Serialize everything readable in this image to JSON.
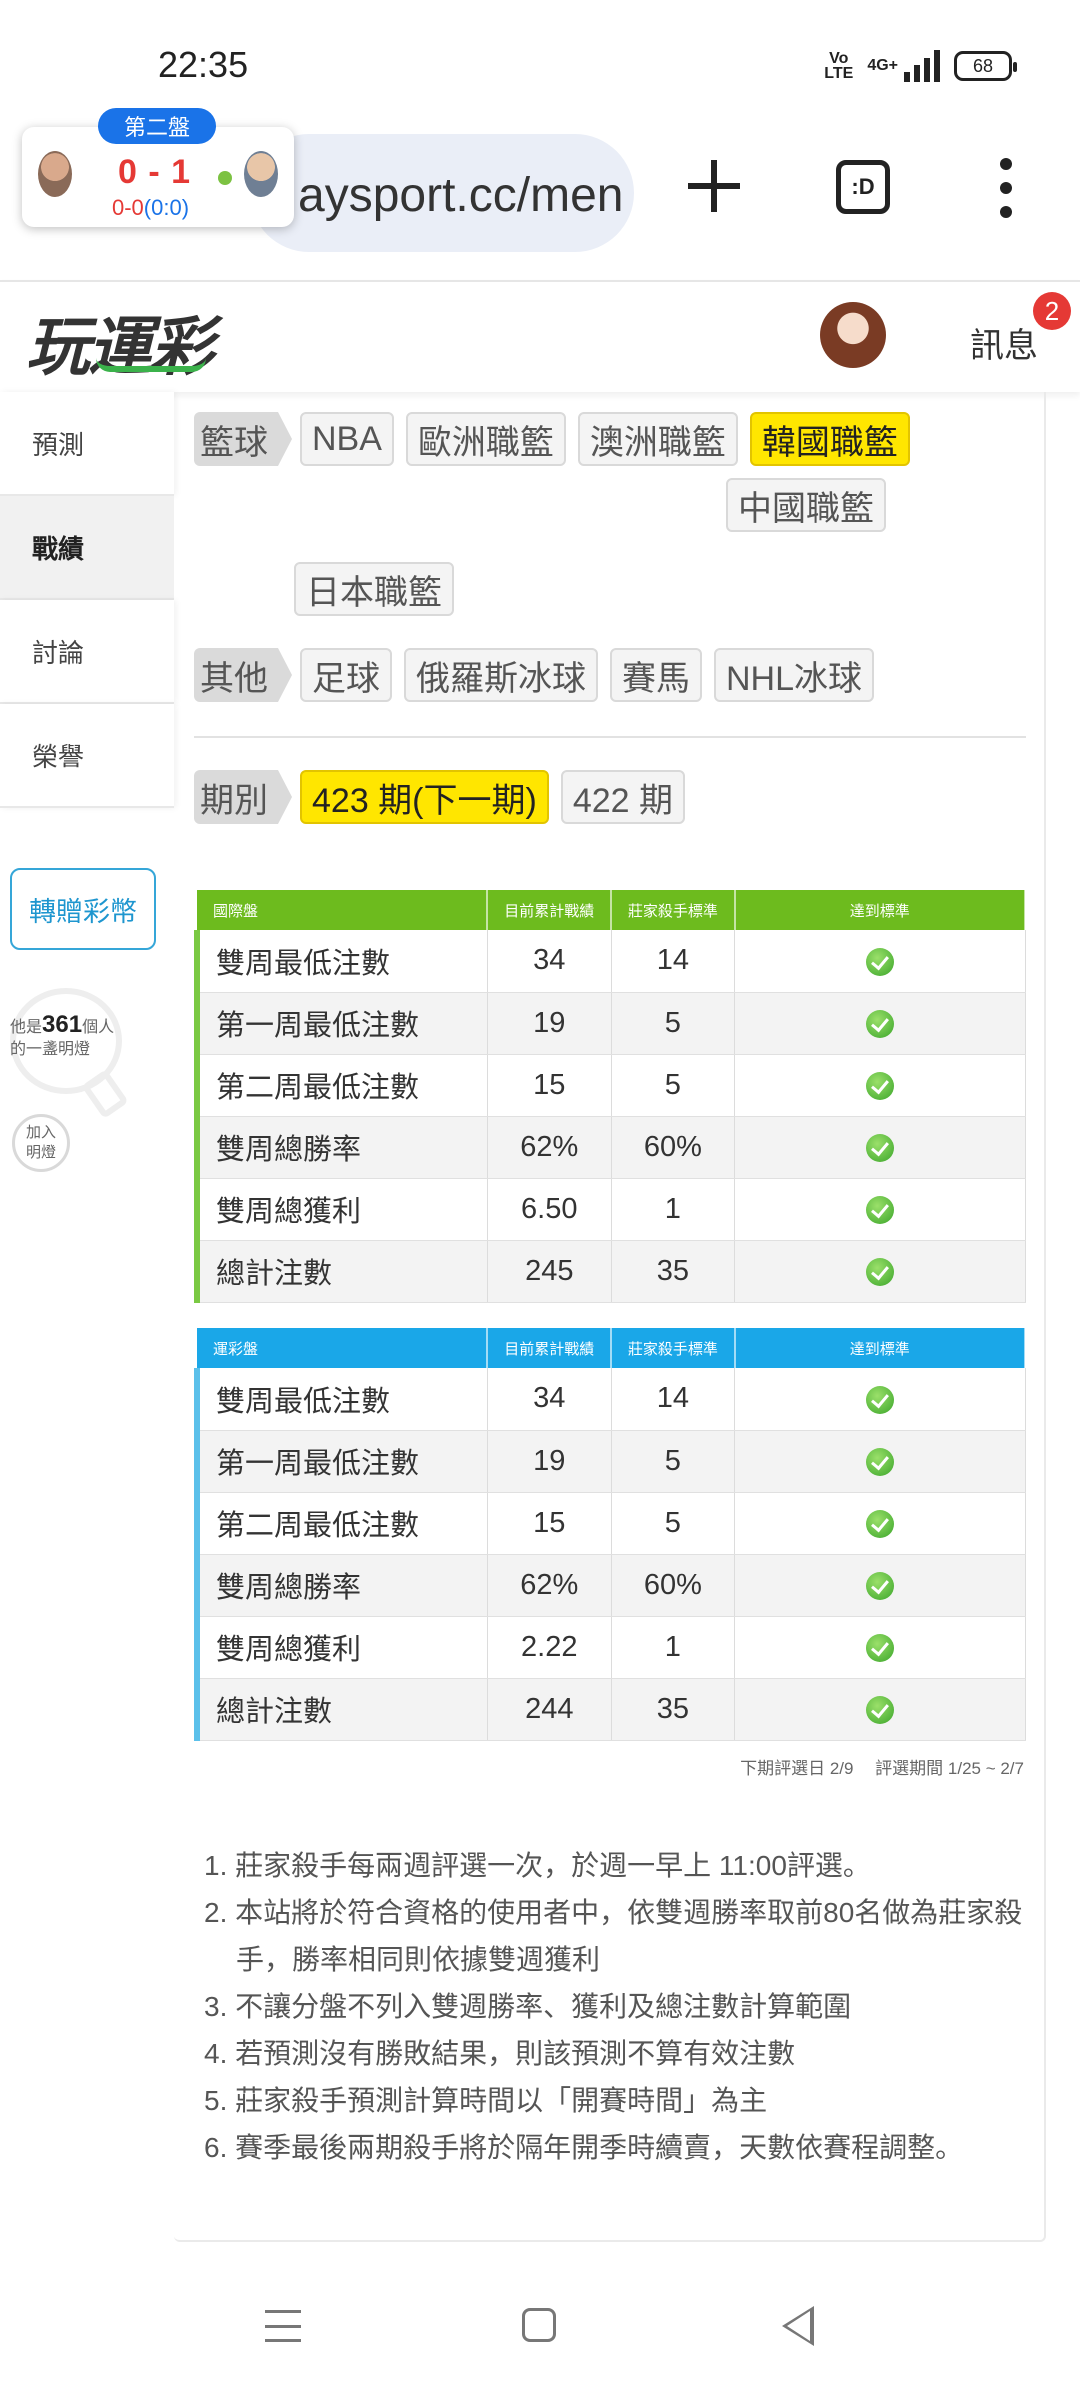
{
  "status": {
    "time": "22:35",
    "volte": "Vo\nLTE",
    "network": "4G+",
    "battery": "68"
  },
  "browser": {
    "url": "aysport.cc/men",
    "tabs_label": ":D"
  },
  "score": {
    "set_label": "第二盤",
    "main": "0 - 1",
    "sub_games": "0-0",
    "sub_points": "(0:0)"
  },
  "header": {
    "logo": "玩運彩",
    "messages_label": "訊息",
    "messages_count": "2"
  },
  "sidebar": {
    "items": [
      {
        "label": "預測"
      },
      {
        "label": "戰績"
      },
      {
        "label": "討論"
      },
      {
        "label": "榮譽"
      }
    ],
    "gift_button": "轉贈彩幣",
    "bulb_prefix": "他是",
    "bulb_count": "361",
    "bulb_suffix": "個人",
    "bulb_line2": "的一盞明燈",
    "join_line1": "加入",
    "join_line2": "明燈"
  },
  "filters": {
    "basketball_label": "籃球",
    "basketball": [
      "NBA",
      "歐洲職籃",
      "澳洲職籃",
      "韓國職籃",
      "中國職籃",
      "日本職籃"
    ],
    "basketball_selected": "韓國職籃",
    "other_label": "其他",
    "other": [
      "足球",
      "俄羅斯冰球",
      "賽馬",
      "NHL冰球"
    ],
    "period_label": "期別",
    "periods": [
      "423 期(下一期)",
      "422 期"
    ],
    "period_selected": "423 期(下一期)"
  },
  "table_headers": [
    "目前累計戰績",
    "莊家殺手標準",
    "達到標準"
  ],
  "international": {
    "title": "國際盤",
    "rows": [
      {
        "name": "雙周最低注數",
        "current": "34",
        "standard": "14"
      },
      {
        "name": "第一周最低注數",
        "current": "19",
        "standard": "5"
      },
      {
        "name": "第二周最低注數",
        "current": "15",
        "standard": "5"
      },
      {
        "name": "雙周總勝率",
        "current": "62%",
        "standard": "60%"
      },
      {
        "name": "雙周總獲利",
        "current": "6.50",
        "standard": "1"
      },
      {
        "name": "總計注數",
        "current": "245",
        "standard": "35"
      }
    ]
  },
  "sportslottery": {
    "title": "運彩盤",
    "rows": [
      {
        "name": "雙周最低注數",
        "current": "34",
        "standard": "14"
      },
      {
        "name": "第一周最低注數",
        "current": "19",
        "standard": "5"
      },
      {
        "name": "第二周最低注數",
        "current": "15",
        "standard": "5"
      },
      {
        "name": "雙周總勝率",
        "current": "62%",
        "standard": "60%"
      },
      {
        "name": "雙周總獲利",
        "current": "2.22",
        "standard": "1"
      },
      {
        "name": "總計注數",
        "current": "244",
        "standard": "35"
      }
    ]
  },
  "period_info": "下期評選日 2/9　 評選期間 1/25 ~ 2/7",
  "notes": [
    "1. 莊家殺手每兩週評選一次，於週一早上 11:00評選。",
    "2. 本站將於符合資格的使用者中，依雙週勝率取前80名做為莊家殺手，勝率相同則依據雙週獲利",
    "3. 不讓分盤不列入雙週勝率、獲利及總注數計算範圍",
    "4. 若預測沒有勝敗結果，則該預測不算有效注數",
    "5. 莊家殺手預測計算時間以「開賽時間」為主",
    "6. 賽季最後兩期殺手將於隔年開季時續賣，天數依賽程調整。"
  ],
  "colors": {
    "international_header": "#6dbb1e",
    "sportslottery_header": "#1aa7e8",
    "selected_tag": "#ffe600",
    "badge": "#e53935"
  },
  "icons": [
    "signal-icon",
    "battery-icon",
    "plus-icon",
    "tabs-icon",
    "more-vert-icon",
    "check-icon",
    "lightbulb-icon",
    "nav-menu-icon",
    "nav-home-icon",
    "nav-back-icon"
  ]
}
